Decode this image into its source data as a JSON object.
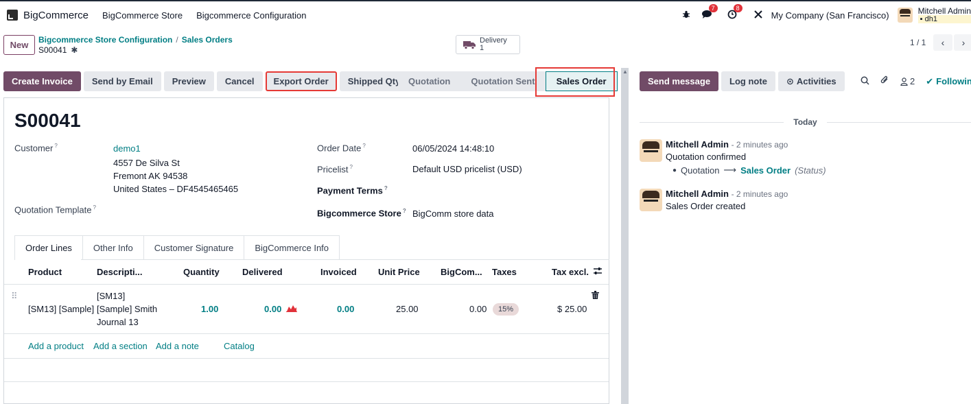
{
  "navbar": {
    "app_name": "BigCommerce",
    "menus": [
      "BigCommerce Store",
      "Bigcommerce Configuration"
    ],
    "messages_count": "7",
    "activities_count": "8",
    "company": "My Company (San Francisco)",
    "user_name": "Mitchell Admin",
    "user_db": "dh1"
  },
  "control": {
    "new_label": "New",
    "breadcrumb_parent": "Bigcommerce Store Configuration",
    "breadcrumb_current": "Sales Orders",
    "record_name": "S00041",
    "delivery_label": "Delivery",
    "delivery_count": "1",
    "pager": "1 / 1"
  },
  "actions": {
    "create_invoice": "Create Invoice",
    "send_email": "Send by Email",
    "preview": "Preview",
    "cancel": "Cancel",
    "export_order": "Export Order",
    "shipped_qty": "Shipped Qty"
  },
  "status": {
    "stages": [
      "Quotation",
      "Quotation Sent",
      "Sales Order"
    ],
    "active": "Sales Order"
  },
  "form": {
    "title": "S00041",
    "customer_label": "Customer",
    "customer_name": "demo1",
    "customer_address1": "4557 De Silva St",
    "customer_address2": "Fremont AK 94538",
    "customer_address3": "United States – DF4545465465",
    "template_label": "Quotation Template",
    "order_date_label": "Order Date",
    "order_date": "06/05/2024 14:48:10",
    "pricelist_label": "Pricelist",
    "pricelist": "Default USD pricelist (USD)",
    "payment_terms_label": "Payment Terms",
    "store_label": "Bigcommerce Store",
    "store": "BigComm store data"
  },
  "tabs": [
    "Order Lines",
    "Other Info",
    "Customer Signature",
    "BigCommerce Info"
  ],
  "table": {
    "columns": [
      "Product",
      "Descripti...",
      "Quantity",
      "Delivered",
      "Invoiced",
      "Unit Price",
      "BigCom...",
      "Taxes",
      "Tax excl."
    ],
    "row": {
      "product": "[SM13] [Sample]",
      "desc1": "[SM13]",
      "desc2": "[Sample] Smith",
      "desc3": "Journal 13",
      "quantity": "1.00",
      "delivered": "0.00",
      "invoiced": "0.00",
      "unit_price": "25.00",
      "bigcom": "0.00",
      "taxes": "15%",
      "tax_excl": "$ 25.00"
    },
    "add_product": "Add a product",
    "add_section": "Add a section",
    "add_note": "Add a note",
    "catalog": "Catalog"
  },
  "chatter": {
    "send_message": "Send message",
    "log_note": "Log note",
    "activities": "Activities",
    "followers_count": "2",
    "following": "Following",
    "today": "Today",
    "messages": [
      {
        "author": "Mitchell Admin",
        "time": "- 2 minutes ago",
        "body": "Quotation confirmed",
        "track_from": "Quotation",
        "track_to": "Sales Order",
        "track_field": "(Status)"
      },
      {
        "author": "Mitchell Admin",
        "time": "- 2 minutes ago",
        "body": "Sales Order created"
      }
    ]
  }
}
